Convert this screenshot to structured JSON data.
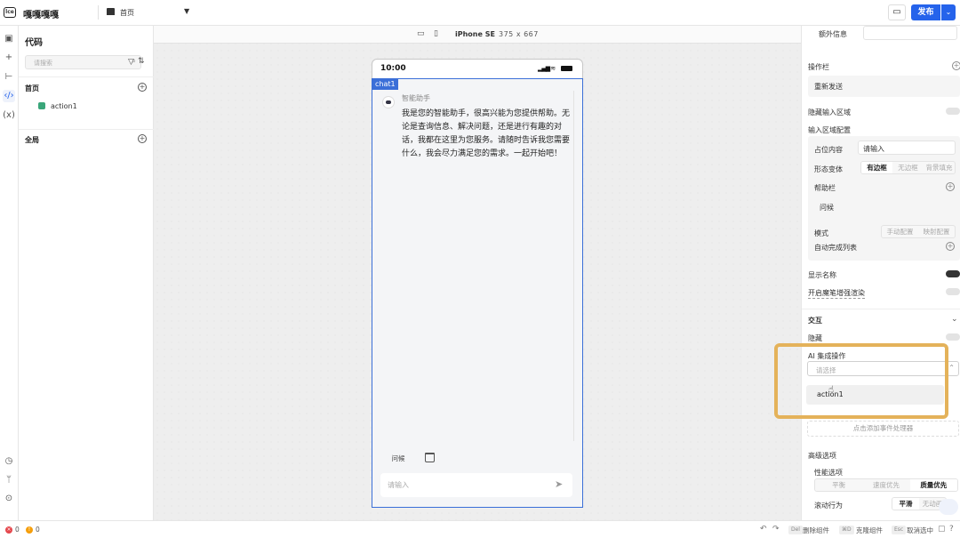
{
  "header": {
    "logo_text": "lce",
    "app_name": "嘎嘎嘎嘎",
    "current_page": "首页",
    "publish_label": "发布"
  },
  "rail": {
    "icons": [
      "layout-icon",
      "add-icon",
      "tree-icon",
      "code-icon",
      "variable-icon",
      "history-icon",
      "branch-icon",
      "settings-icon"
    ]
  },
  "left_panel": {
    "title": "代码",
    "search_placeholder": "请搜索",
    "sections": [
      {
        "label": "首页",
        "items": [
          "action1"
        ]
      },
      {
        "label": "全局",
        "items": []
      }
    ]
  },
  "device_bar": {
    "device_name": "iPhone SE",
    "size": "375 x 667"
  },
  "phone": {
    "time": "10:00",
    "component_tag": "chat1",
    "assistant_name": "智能助手",
    "assistant_message": "我是您的智能助手，很高兴能为您提供帮助。无论是查询信息、解决问题，还是进行有趣的对话，我都在这里为您服务。请随时告诉我您需要什么，我会尽力满足您的需求。一起开始吧！",
    "quick_action": "问候",
    "input_placeholder": "请输入"
  },
  "right_panel": {
    "extra_info_label": "额外信息",
    "action_bar_label": "操作栏",
    "resend_label": "重新发送",
    "hide_input_label": "隐藏输入区域",
    "input_config_label": "输入区域配置",
    "placeholder_label": "占位内容",
    "placeholder_value": "请输入",
    "variant_label": "形态变体",
    "variant_options": [
      "有边框",
      "无边框",
      "背景填充"
    ],
    "variant_active": 0,
    "help_bar_label": "帮助栏",
    "help_item": "问候",
    "mode_label": "模式",
    "mode_options": [
      "手动配置",
      "映射配置"
    ],
    "autocomplete_label": "自动完成列表",
    "show_name_label": "显示名称",
    "show_name_on": true,
    "magic_pen_label": "开启魔笔增强渲染",
    "interaction_label": "交互",
    "hide_label": "隐藏",
    "ai_actions_label": "AI 集成操作",
    "ai_select_placeholder": "请选择",
    "ai_option": "action1",
    "add_event_label": "点击添加事件处理器",
    "advanced_label": "高级选项",
    "perf_label": "性能选项",
    "perf_options": [
      "平衡",
      "速度优先",
      "质量优先"
    ],
    "perf_active": 2,
    "scroll_label": "滚动行为",
    "scroll_options": [
      "平滑",
      "无动画"
    ],
    "scroll_active": 0
  },
  "status_bar": {
    "errors": "0",
    "warnings": "0",
    "shortcuts": [
      {
        "key": "Del",
        "label": "删除组件"
      },
      {
        "key": "⌘D",
        "label": "克隆组件"
      },
      {
        "key": "Esc",
        "label": "取消选中"
      }
    ]
  },
  "colors": {
    "accent": "#2563eb",
    "selection": "#3b6fd8",
    "highlight": "#e4b25a",
    "error": "#e5484d",
    "warning": "#f59e0b"
  }
}
